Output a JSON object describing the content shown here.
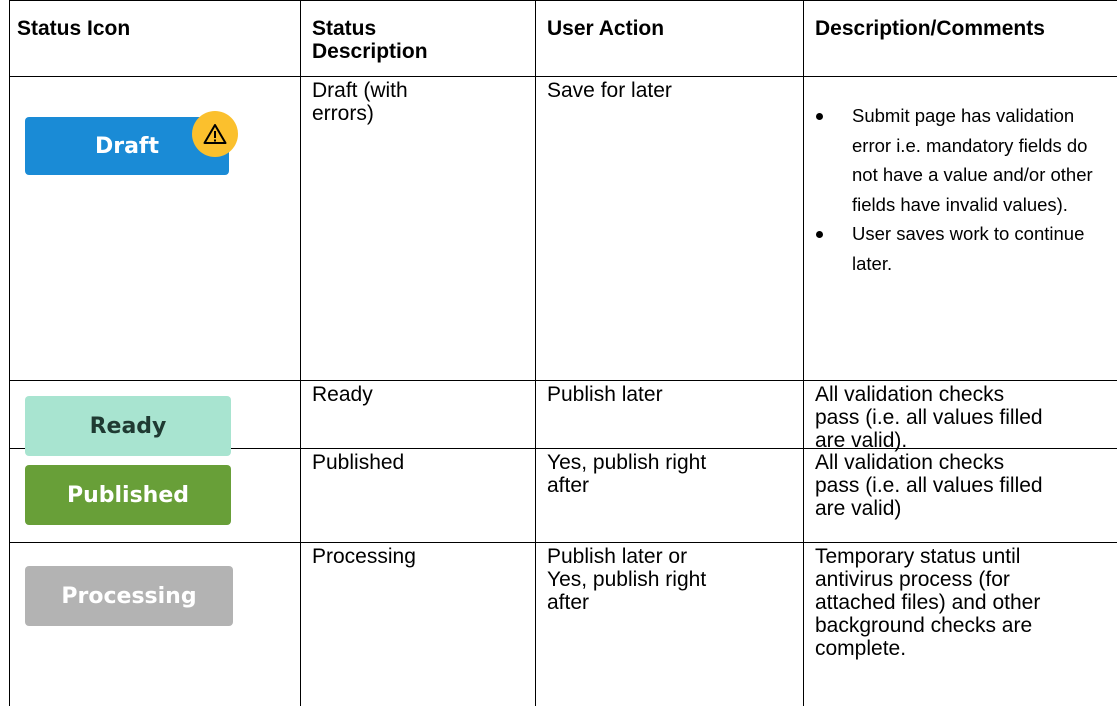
{
  "headers": {
    "status_icon": "Status Icon",
    "status_description": "Status\nDescription",
    "user_action": "User Action",
    "description": "Description/Comments"
  },
  "rows": [
    {
      "badge": {
        "label": "Draft",
        "color": "#1a8bd6",
        "text_color": "#ffffff",
        "icon": "warning-triangle-icon",
        "icon_color": "#fbc02d"
      },
      "status": "Draft (with\nerrors)",
      "action": "Save for later",
      "comments_bullets": [
        "Submit page has validation error i.e. mandatory fields do not have a value and/or other fields have invalid values).",
        "User saves work to continue later."
      ]
    },
    {
      "badge": {
        "label": "Ready",
        "color": "#a8e4d0",
        "text_color": "#1f3a32"
      },
      "status": "Ready",
      "action": "Publish later",
      "comments": "All validation checks\npass (i.e. all values filled\nare valid)."
    },
    {
      "badge": {
        "label": "Published",
        "color": "#689f38",
        "text_color": "#ffffff"
      },
      "status": "Published",
      "action": "Yes, publish right\nafter",
      "comments": "All validation checks\npass (i.e. all values filled\nare valid)"
    },
    {
      "badge": {
        "label": "Processing",
        "color": "#b3b3b3",
        "text_color": "#ffffff"
      },
      "status": "Processing",
      "action": "Publish later or\nYes, publish right\nafter",
      "comments": "Temporary status until\nantivirus process (for\nattached files) and other\nbackground checks are\ncomplete."
    }
  ]
}
